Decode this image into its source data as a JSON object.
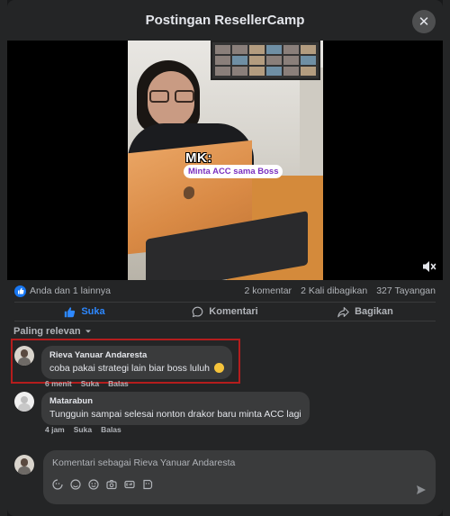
{
  "dialog": {
    "title": "Postingan ResellerCamp",
    "close_glyph": "✕"
  },
  "video": {
    "overlay_mk": "MK:",
    "overlay_caption": "Minta ACC sama Boss",
    "mute_icon": "volume-muted-icon"
  },
  "stats": {
    "reactions": "Anda dan 1 lainnya",
    "comments": "2 komentar",
    "shares": "2 Kali dibagikan",
    "views": "327 Tayangan"
  },
  "actions": {
    "like": "Suka",
    "comment": "Komentari",
    "share": "Bagikan",
    "like_color": "#2d88ff"
  },
  "sort": {
    "label": "Paling relevan"
  },
  "comments": [
    {
      "author": "Rieva Yanuar Andaresta",
      "text": "coba pakai strategi lain biar boss luluh",
      "time": "6 menit",
      "like": "Suka",
      "reply": "Balas"
    },
    {
      "author": "Matarabun",
      "text": "Tungguin sampai selesai nonton drakor baru minta ACC lagi",
      "time": "4 jam",
      "like": "Suka",
      "reply": "Balas"
    }
  ],
  "composer": {
    "placeholder": "Komentari sebagai Rieva Yanuar Andaresta",
    "tools": [
      "avatar-sticker-icon",
      "gif-icon",
      "emoji-icon",
      "camera-icon",
      "gif-icon",
      "sticker-icon"
    ]
  },
  "colors": {
    "background": "#242526",
    "bubble": "#3a3b3c",
    "highlight": "#b51d1d",
    "link_blue": "#1877f2"
  }
}
